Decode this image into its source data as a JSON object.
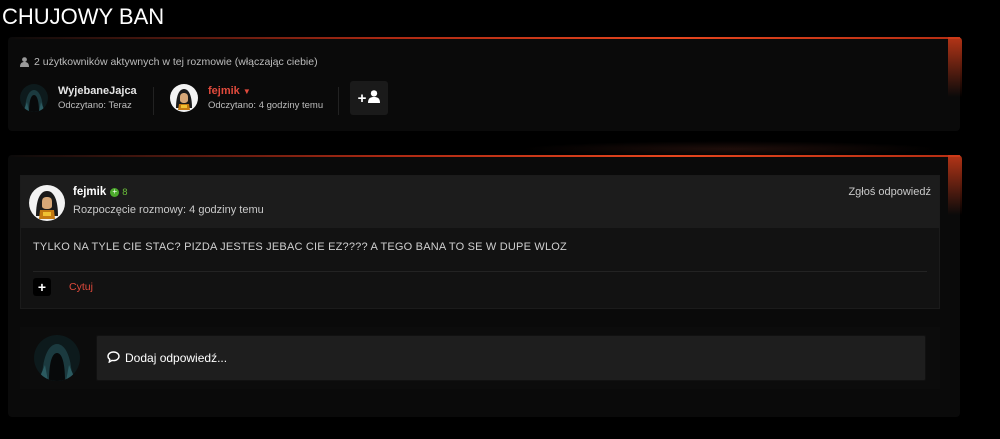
{
  "page": {
    "title": "CHUJOWY BAN"
  },
  "participants": {
    "header": "2 użytkowników aktywnych w tej rozmowie (włączając ciebie)",
    "users": [
      {
        "name": "WyjebaneJajca",
        "status": "Odczytano: Teraz",
        "icon": "hooded-avatar"
      },
      {
        "name": "fejmik",
        "status": "Odczytano: 4 godziny temu",
        "icon": "character-avatar",
        "dropdown": "caret-down-icon"
      }
    ],
    "add_button_icon": "plus-user-icon"
  },
  "message": {
    "author": "fejmik",
    "reputation": "8",
    "date": "Rozpoczęcie rozmowy: 4 godziny temu",
    "report_label": "Zgłoś odpowiedź",
    "body": "TYLKO NA TYLE CIE STAC? PIZDA JESTES JEBAC CIE EZ???? A TEGO BANA TO SE W DUPE WLOZ",
    "quote_label": "Cytuj"
  },
  "reply": {
    "placeholder": "Dodaj odpowiedź..."
  },
  "colors": {
    "accent": "#e04a3c",
    "background": "#000000",
    "rep": "#4caa2c"
  }
}
